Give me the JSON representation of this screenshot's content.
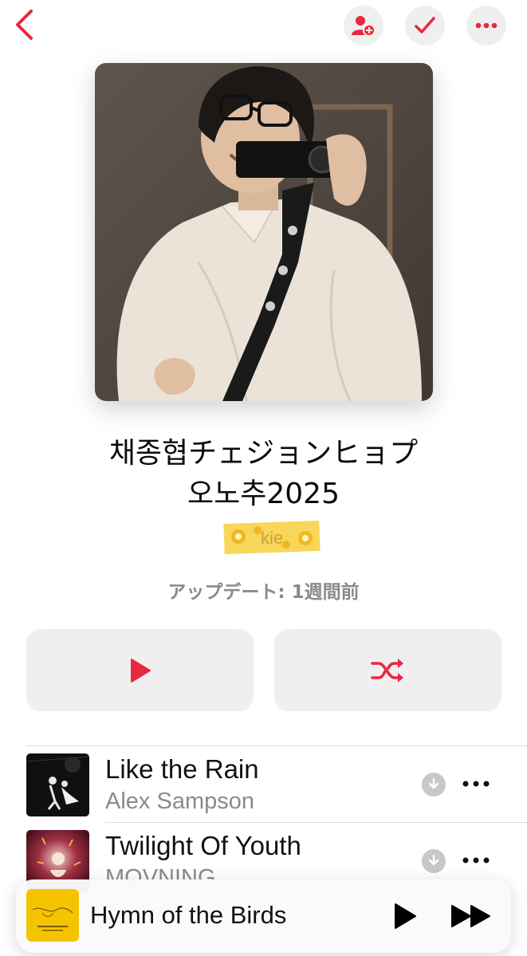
{
  "playlist": {
    "title_line1": "채종협チェジョンヒョプ",
    "title_line2": "오노추2025",
    "sticker_text": "kie",
    "updated": "アップデート: 1週間前"
  },
  "nav": {
    "icons": [
      "chevron-left-icon",
      "add-person-icon",
      "checkmark-icon",
      "more-icon"
    ]
  },
  "actions": {
    "icons": [
      "play-icon",
      "shuffle-icon"
    ]
  },
  "tracks": [
    {
      "title": "Like the Rain",
      "artist": "Alex Sampson"
    },
    {
      "title": "Twilight Of Youth",
      "artist": "MOVNING"
    }
  ],
  "now_playing": {
    "title": "Hymn of the Birds"
  },
  "colors": {
    "accent": "#e8283e",
    "button_bg": "#efefef",
    "secondary_text": "#8a8a8e",
    "mini_art": "#f5c400"
  }
}
